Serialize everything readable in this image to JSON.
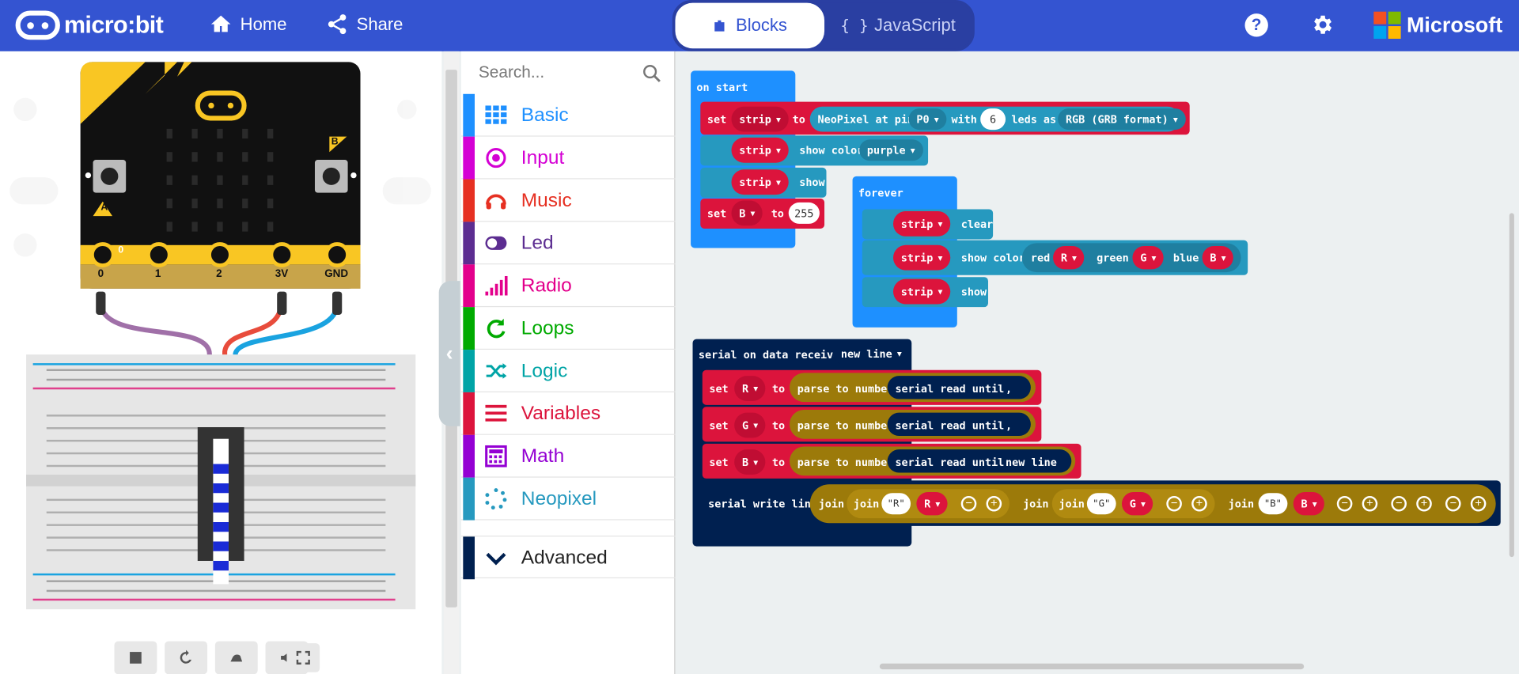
{
  "header": {
    "logo_text": "micro:bit",
    "home_label": "Home",
    "share_label": "Share",
    "blocks_label": "Blocks",
    "javascript_label": "JavaScript",
    "brand_label": "Microsoft"
  },
  "simulator": {
    "pin_labels": [
      "0",
      "1",
      "2",
      "3V",
      "GND"
    ],
    "button_a": "A",
    "button_b": "B",
    "pin0_marker": "0"
  },
  "toolbox": {
    "search_placeholder": "Search...",
    "categories": [
      {
        "label": "Basic",
        "color": "#1e90ff"
      },
      {
        "label": "Input",
        "color": "#d400d4"
      },
      {
        "label": "Music",
        "color": "#e63022"
      },
      {
        "label": "Led",
        "color": "#5c2d91"
      },
      {
        "label": "Radio",
        "color": "#e3008c"
      },
      {
        "label": "Loops",
        "color": "#00aa00"
      },
      {
        "label": "Logic",
        "color": "#00a4a6"
      },
      {
        "label": "Variables",
        "color": "#dc143c"
      },
      {
        "label": "Math",
        "color": "#9400d3"
      },
      {
        "label": "Neopixel",
        "color": "#2699bf"
      },
      {
        "label": "Advanced",
        "color": "#002050"
      }
    ]
  },
  "workspace": {
    "on_start": {
      "header": "on start",
      "set1": {
        "set": "set",
        "var": "strip",
        "to": "to",
        "neopixel": "NeoPixel at pin",
        "pin": "P0",
        "with": "with",
        "count": "6",
        "leds_as": "leds as",
        "format": "RGB (GRB format)"
      },
      "show_color": {
        "var": "strip",
        "action": "show color",
        "color": "purple"
      },
      "show": {
        "var": "strip",
        "action": "show"
      },
      "set2": {
        "set": "set",
        "var": "B",
        "to": "to",
        "value": "255"
      }
    },
    "forever": {
      "header": "forever",
      "clear": {
        "var": "strip",
        "action": "clear"
      },
      "show_color": {
        "var": "strip",
        "action": "show color",
        "red": "red",
        "r": "R",
        "green": "green",
        "g": "G",
        "blue": "blue",
        "b": "B"
      },
      "show": {
        "var": "strip",
        "action": "show"
      }
    },
    "serial": {
      "header": "serial on data received",
      "delimiter": "new line",
      "set_r": {
        "set": "set",
        "var": "R",
        "to": "to",
        "parse": "parse to number",
        "read": "serial read until",
        "sep": ","
      },
      "set_g": {
        "set": "set",
        "var": "G",
        "to": "to",
        "parse": "parse to number",
        "read": "serial read until",
        "sep": ","
      },
      "set_b": {
        "set": "set",
        "var": "B",
        "to": "to",
        "parse": "parse to number",
        "read": "serial read until",
        "sep": "new line"
      },
      "write": {
        "label": "serial write line",
        "join": "join",
        "s1": "R",
        "v1": "R",
        "s2": "G",
        "v2": "G",
        "s3": "B",
        "v3": "B"
      }
    }
  },
  "colors": {
    "header_bg": "#3454d1",
    "variables": "#dc143c",
    "neopixel": "#2699bf",
    "basic": "#1e90ff",
    "serial": "#002050",
    "math": "#9c7a0a"
  }
}
